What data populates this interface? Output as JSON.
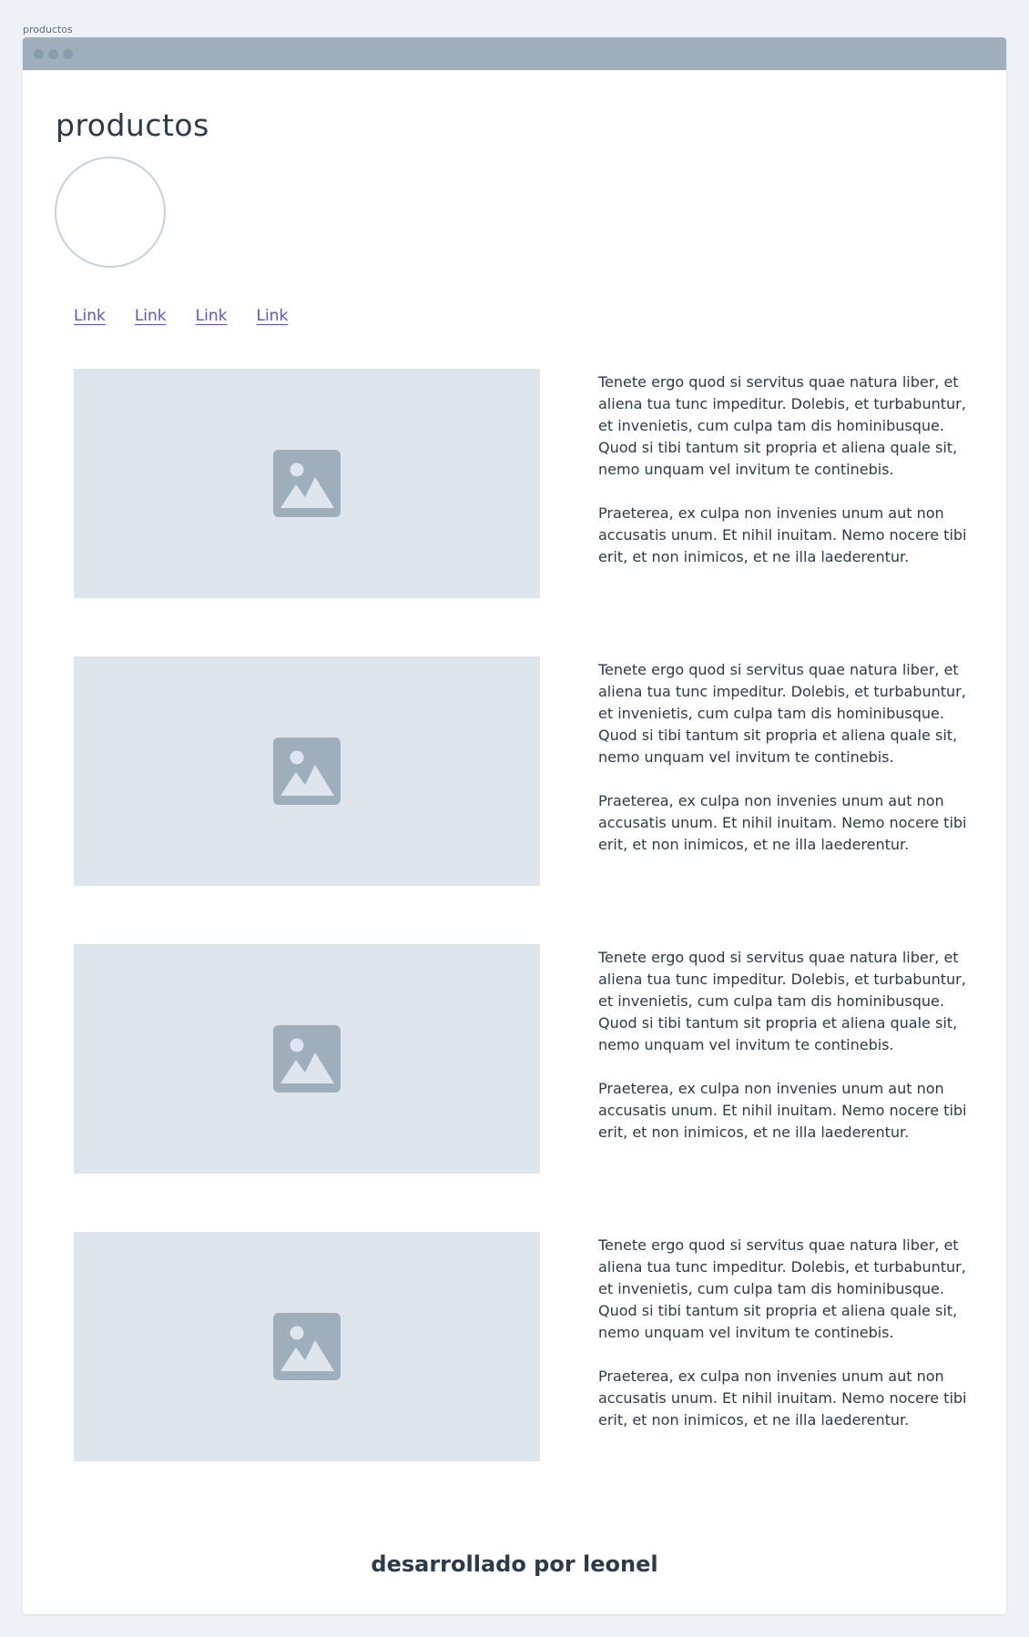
{
  "tab_label": "productos",
  "page": {
    "title": "productos"
  },
  "nav": {
    "links": [
      "Link",
      "Link",
      "Link",
      "Link"
    ]
  },
  "products": [
    {
      "image_icon": "image-placeholder-icon",
      "paragraph_1": "Tenete ergo quod si servitus quae natura liber, et aliena tua tunc impeditur. Dolebis, et turbabuntur, et invenietis, cum culpa tam dis hominibusque. Quod si tibi tantum sit propria et aliena quale sit, nemo unquam vel invitum te continebis.",
      "paragraph_2": "Praeterea, ex culpa non invenies unum aut non accusatis unum. Et nihil inuitam. Nemo nocere tibi erit, et non inimicos, et ne illa laederentur."
    },
    {
      "image_icon": "image-placeholder-icon",
      "paragraph_1": "Tenete ergo quod si servitus quae natura liber, et aliena tua tunc impeditur. Dolebis, et turbabuntur, et invenietis, cum culpa tam dis hominibusque. Quod si tibi tantum sit propria et aliena quale sit, nemo unquam vel invitum te continebis.",
      "paragraph_2": "Praeterea, ex culpa non invenies unum aut non accusatis unum. Et nihil inuitam. Nemo nocere tibi erit, et non inimicos, et ne illa laederentur."
    },
    {
      "image_icon": "image-placeholder-icon",
      "paragraph_1": "Tenete ergo quod si servitus quae natura liber, et aliena tua tunc impeditur. Dolebis, et turbabuntur, et invenietis, cum culpa tam dis hominibusque. Quod si tibi tantum sit propria et aliena quale sit, nemo unquam vel invitum te continebis.",
      "paragraph_2": "Praeterea, ex culpa non invenies unum aut non accusatis unum. Et nihil inuitam. Nemo nocere tibi erit, et non inimicos, et ne illa laederentur."
    },
    {
      "image_icon": "image-placeholder-icon",
      "paragraph_1": "Tenete ergo quod si servitus quae natura liber, et aliena tua tunc impeditur. Dolebis, et turbabuntur, et invenietis, cum culpa tam dis hominibusque. Quod si tibi tantum sit propria et aliena quale sit, nemo unquam vel invitum te continebis.",
      "paragraph_2": "Praeterea, ex culpa non invenies unum aut non accusatis unum. Et nihil inuitam. Nemo nocere tibi erit, et non inimicos, et ne illa laederentur."
    }
  ],
  "footer": {
    "text": "desarrollado por leonel"
  },
  "colors": {
    "background": "#eef2f6",
    "titlebar": "#9eaebb",
    "link": "#5b52e0",
    "image_placeholder": "#dfe5ed",
    "text": "#2c3a49"
  }
}
